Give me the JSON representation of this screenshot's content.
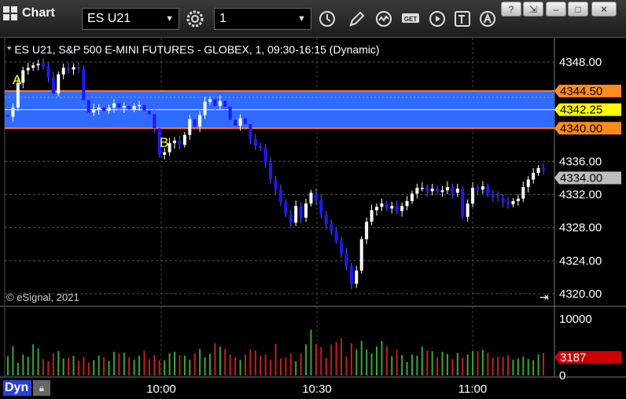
{
  "toolbar": {
    "title": "Chart",
    "symbol": "ES U21",
    "interval": "1",
    "icons": [
      "grid-icon",
      "settings-gear-icon",
      "clock-icon",
      "pencil-draw-icon",
      "indicator-icon",
      "get-data-icon",
      "play-icon",
      "text-tool-icon",
      "alert-icon"
    ]
  },
  "window_controls": [
    "help-icon",
    "restore-icon",
    "minimize-icon",
    "maximize-icon",
    "close-icon"
  ],
  "info_line": "* ES U21, S&P 500 E-MINI FUTURES - GLOBEX, 1, 09:30-16:15 (Dynamic)",
  "copyright": "© eSignal, 2021",
  "footer_mode": "Dyn",
  "annotations": [
    {
      "label": "A",
      "color": "#ffff33"
    },
    {
      "label": "B",
      "color": "#ffff33"
    }
  ],
  "colors": {
    "band": "#2f6bff",
    "band_border": "#ff7a1a",
    "up_candle": "#ffffff",
    "down_candle": "#1a1aff",
    "volume_up": "#33aa33",
    "volume_down": "#c0201f"
  },
  "chart_data": [
    {
      "type": "candlestick",
      "title": "",
      "yticks": [
        "4348.00",
        "4336.00",
        "4332.00",
        "4328.00",
        "4324.00",
        "4320.00"
      ],
      "xticks": [
        "10:00",
        "10:30",
        "11:00"
      ],
      "ylim": [
        4319,
        4350
      ],
      "price_labels": [
        {
          "value": 4344.5,
          "text": "4344.50",
          "bg": "#ff8c1a",
          "fg": "#000000"
        },
        {
          "value": 4342.25,
          "text": "4342.25",
          "bg": "#ffff00",
          "fg": "#000000"
        },
        {
          "value": 4340.0,
          "text": "4340.00",
          "bg": "#ff8c1a",
          "fg": "#000000"
        },
        {
          "value": 4334.0,
          "text": "4334.00",
          "bg": "#bdbdbd",
          "fg": "#000000"
        }
      ],
      "band": {
        "low": 4340.0,
        "high": 4344.5,
        "mid": 4342.25
      },
      "series": [
        {
          "name": "close",
          "values": [
            4341.4,
            4342.5,
            4345.5,
            4347.0,
            4347.3,
            4347.6,
            4347.8,
            4347.5,
            4346.2,
            4344.2,
            4346.5,
            4347.3,
            4347.1,
            4347.4,
            4347.2,
            4343.4,
            4341.9,
            4342.3,
            4342.5,
            4342.1,
            4342.5,
            4343.0,
            4342.5,
            4342.7,
            4342.3,
            4342.7,
            4342.8,
            4342.1,
            4341.7,
            4340.0,
            4336.8,
            4337.1,
            4338.2,
            4338.5,
            4338.0,
            4339.2,
            4341.1,
            4340.2,
            4341.6,
            4343.2,
            4343.5,
            4342.7,
            4343.3,
            4342.6,
            4341.0,
            4340.3,
            4341.2,
            4340.5,
            4338.7,
            4337.9,
            4337.6,
            4335.8,
            4333.8,
            4332.6,
            4331.1,
            4329.6,
            4328.6,
            4330.6,
            4329.2,
            4330.9,
            4332.2,
            4331.3,
            4329.6,
            4328.4,
            4327.6,
            4326.4,
            4324.9,
            4323.3,
            4321.2,
            4322.8,
            4326.6,
            4328.7,
            4330.1,
            4330.5,
            4330.9,
            4330.3,
            4330.6,
            4330.0,
            4330.6,
            4331.2,
            4332.1,
            4332.8,
            4332.8,
            4332.4,
            4332.7,
            4332.3,
            4332.5,
            4332.9,
            4332.2,
            4332.7,
            4329.3,
            4330.9,
            4332.8,
            4332.6,
            4333.0,
            4332.0,
            4331.7,
            4331.6,
            4331.1,
            4330.8,
            4331.2,
            4331.5,
            4332.9,
            4333.8,
            4334.6,
            4335.2,
            4335.0
          ]
        },
        {
          "name": "volume",
          "values": [
            3400,
            5200,
            2200,
            3700,
            3300,
            5500,
            4800,
            2900,
            2500,
            3900,
            4300,
            3000,
            3100,
            3500,
            2600,
            3300,
            2300,
            2700,
            3500,
            3200,
            2600,
            4200,
            3900,
            4000,
            3200,
            2800,
            3500,
            4400,
            2900,
            3600,
            2700,
            2700,
            3900,
            4200,
            3600,
            3500,
            2800,
            3900,
            4700,
            3200,
            3800,
            5700,
            5100,
            4700,
            3700,
            3200,
            2800,
            3700,
            4600,
            4400,
            3500,
            3700,
            2800,
            5600,
            3000,
            3200,
            3900,
            2500,
            3900,
            5500,
            8100,
            5500,
            5000,
            3100,
            5500,
            5900,
            6600,
            3400,
            5700,
            4600,
            6100,
            4600,
            3900,
            5100,
            6100,
            5200,
            3400,
            4500,
            3600,
            2400,
            3700,
            3500,
            5100,
            4400,
            4300,
            3200,
            4200,
            3800,
            2900,
            4000,
            3100,
            3700,
            4300,
            4300,
            4500,
            4000,
            3100,
            3300,
            3300,
            3600,
            2800,
            3000,
            3300,
            2900,
            2700,
            3700,
            4000
          ]
        }
      ],
      "volume_ticks": [
        "10000",
        "0"
      ],
      "volume_label": {
        "value": 3187,
        "text": "3187",
        "bg": "#cc0000",
        "fg": "#ffffff"
      }
    }
  ]
}
